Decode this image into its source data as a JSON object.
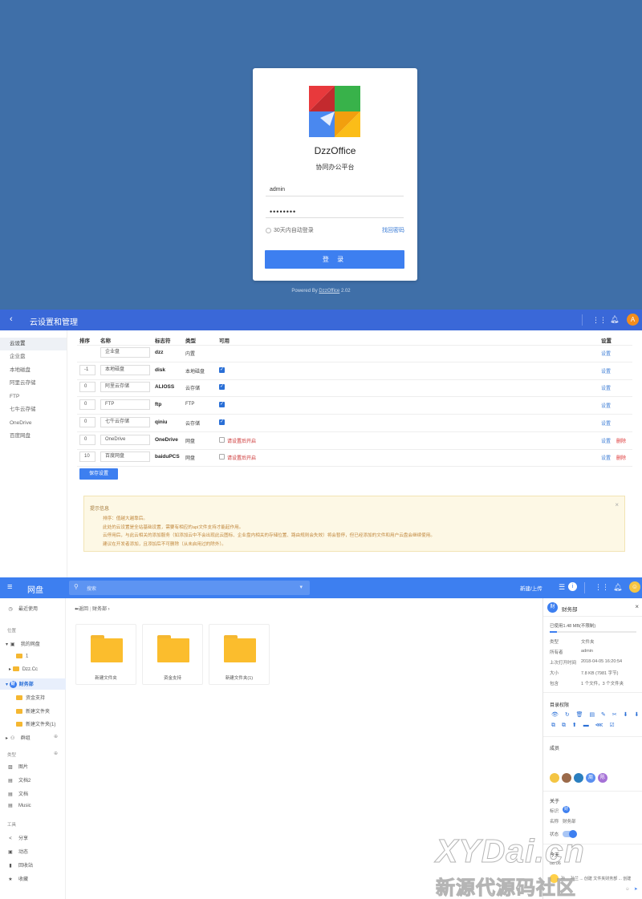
{
  "login": {
    "brand": "DzzOffice",
    "subtitle": "协同办公平台",
    "username": "admin",
    "password": "••••••••",
    "remember": "30天内自动登录",
    "forgot": "找回密码",
    "button": "登 录",
    "powered_prefix": "Powered By ",
    "powered_link": "DzzOffice",
    "powered_version": " 2.02",
    "logo_colors": {
      "red": "#e8393c",
      "green": "#38b24a",
      "blue": "#4a88ef",
      "yellow": "#fbbd18"
    }
  },
  "cloud": {
    "back_icon": "‹",
    "title": "云设置和管理",
    "avatar": "A",
    "sidebar": [
      "云设置",
      "企业盘",
      "本地磁盘",
      "阿里云存储",
      "FTP",
      "七牛云存储",
      "OneDrive",
      "百度网盘"
    ],
    "headers": {
      "order": "排序",
      "name": "名称",
      "tag": "标志符",
      "type": "类型",
      "enabled": "可用",
      "settings": "设置"
    },
    "rows": [
      {
        "order": "",
        "name": "企业盘",
        "tag": "dzz",
        "type": "内置",
        "enabled": "none",
        "set": "设置",
        "del": ""
      },
      {
        "order": "-1",
        "name": "本地磁盘",
        "tag": "disk",
        "type": "本地磁盘",
        "enabled": "checked",
        "set": "设置",
        "del": ""
      },
      {
        "order": "0",
        "name": "阿里云存储",
        "tag": "ALIOSS",
        "type": "云存储",
        "enabled": "checked",
        "set": "设置",
        "del": ""
      },
      {
        "order": "0",
        "name": "FTP",
        "tag": "ftp",
        "type": "FTP",
        "enabled": "checked",
        "set": "设置",
        "del": ""
      },
      {
        "order": "0",
        "name": "七牛云存储",
        "tag": "qiniu",
        "type": "云存储",
        "enabled": "checked",
        "set": "设置",
        "del": ""
      },
      {
        "order": "0",
        "name": "OneDrive",
        "tag": "OneDrive",
        "type": "网盘",
        "enabled": "unchecked",
        "warn": "请设置后开启",
        "set": "设置",
        "del": "删除"
      },
      {
        "order": "10",
        "name": "百度网盘",
        "tag": "baiduPCS",
        "type": "网盘",
        "enabled": "unchecked",
        "warn": "请设置后开启",
        "set": "设置",
        "del": "删除"
      }
    ],
    "save": "保存设置",
    "tips_title": "提示信息",
    "tips": [
      "排序：值越大越靠后。",
      "此处的云设置是全站基础设置，需要有相应的api文件支持才能起作用。",
      "云停用后，与此云相关的添加服务（如添加云中不会出现此云图标、企业盘内相关的存储位置、路由规则会失效）将会暂停，但已经添加的文件和用户云盘会继续使用。",
      "建议在开发者添加，且添加后不可删除（从未启用过的除外）。"
    ]
  },
  "drive": {
    "title": "网盘",
    "search_placeholder": "搜索",
    "upload": "新建/上传",
    "sidebar": {
      "recent": "最近使用",
      "position": "位置",
      "my_drive": "我的网盘",
      "item_1": "1",
      "dzzcc": "Dzz.Cc",
      "finance": "财务部",
      "finance_badge": "财",
      "fund": "资金支持",
      "new_folder": "新建文件夹",
      "new_folder_1": "新建文件夹(1)",
      "group": "群组",
      "types": "类型",
      "pictures": "图片",
      "docs2": "文档2",
      "docs": "文档",
      "music": "Music",
      "tools": "工具",
      "share": "分享",
      "dynamic": "动态",
      "recycle": "回收站",
      "favorites": "收藏"
    },
    "crumb": {
      "back": "返回",
      "path": "财务部"
    },
    "folders": [
      "新建文件夹",
      "资金支持",
      "新建文件夹(1)"
    ],
    "panel": {
      "badge": "财",
      "title": "财务部",
      "usage": "已使用1.48 MB(不限制)",
      "usage_fraction": 0.08,
      "info": [
        {
          "k": "类型",
          "v": "文件夹"
        },
        {
          "k": "所有者",
          "v": "admin"
        },
        {
          "k": "上次打开时间",
          "v": "2018-04-05 16:20:54"
        },
        {
          "k": "大小",
          "v": "7.8 KB (7981 字节)"
        },
        {
          "k": "包含",
          "v": "1 个文件，3 个文件夹"
        }
      ],
      "perm_title": "目录权限",
      "perm_row1": "👁 ↻ 🗑 ▤ ✎ ✂ ⬇ ⬇",
      "perm_row2": "⧉ ⧉ ⬆ ▬ ⋘ ☑",
      "members_title": "成员",
      "member_labels": [
        "周",
        "陈"
      ],
      "about_title": "关于",
      "about_icon_k": "标识",
      "about_icon_v": "财",
      "about_name_k": "名称",
      "about_name_v": "财务部",
      "about_state_k": "状态",
      "today": "今天",
      "time": "08:06",
      "activity": "孙 ... 孙兰 ... 创建 文件夹财务部 ... 创建"
    }
  },
  "watermark": {
    "line1": "XYDai.cn",
    "line2": "新源代源码社区"
  }
}
